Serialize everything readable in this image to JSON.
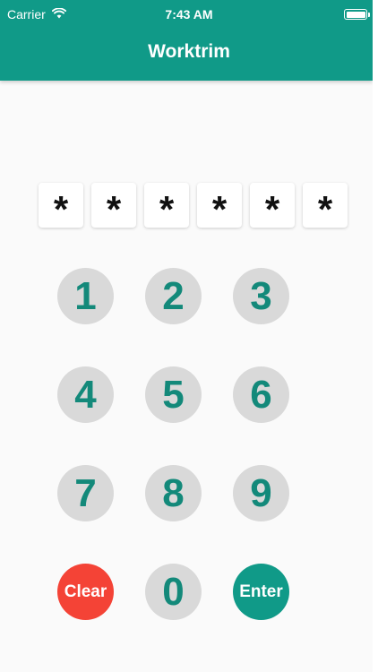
{
  "status_bar": {
    "carrier": "Carrier",
    "time": "7:43 AM",
    "wifi_icon": "wifi-icon",
    "battery_icon": "battery-icon"
  },
  "header": {
    "title": "Worktrim",
    "color": "#109a88"
  },
  "pin": {
    "mask_char": "*",
    "digits": [
      "*",
      "*",
      "*",
      "*",
      "*",
      "*"
    ]
  },
  "keypad": {
    "keys": [
      "1",
      "2",
      "3",
      "4",
      "5",
      "6",
      "7",
      "8",
      "9",
      "Clear",
      "0",
      "Enter"
    ],
    "clear_color": "#f44336",
    "enter_color": "#109a88",
    "digit_color": "#13897a",
    "key_background": "#d9d9d9"
  }
}
